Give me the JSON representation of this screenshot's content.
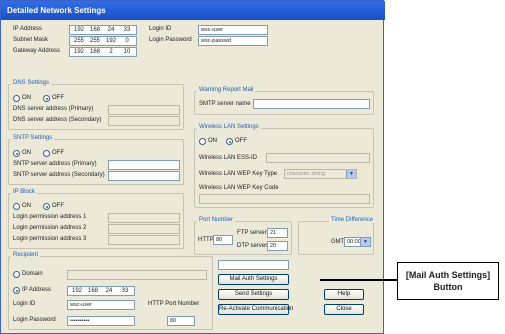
{
  "window": {
    "title": "Detailed Network Settings"
  },
  "network": {
    "ip_label": "IP Address",
    "ip": [
      "192",
      "168",
      "24",
      "33"
    ],
    "mask_label": "Subnet Mask",
    "mask": [
      "255",
      "255",
      "192",
      "0"
    ],
    "gateway_label": "Gateway Address",
    "gateway": [
      "192",
      "168",
      "2",
      "10"
    ],
    "login_id_label": "Login ID",
    "login_id": "wsc-user",
    "login_pw_label": "Login Password",
    "login_pw": "wsc-passwd"
  },
  "dns": {
    "title": "DNS Settings",
    "on": "ON",
    "off": "OFF",
    "primary_label": "DNS server address (Primary)",
    "secondary_label": "DNS server address (Secondary)"
  },
  "sntp": {
    "title": "SNTP Settings",
    "on": "ON",
    "off": "OFF",
    "primary_label": "SNTP server address (Primary)",
    "secondary_label": "SNTP server address (Secondary)"
  },
  "ipblock": {
    "title": "IP Block",
    "on": "ON",
    "off": "OFF",
    "addr1_label": "Login permission address 1",
    "addr2_label": "Login permission address 2",
    "addr3_label": "Login permission address 3"
  },
  "recipient": {
    "title": "Recipient",
    "domain_label": "Domain",
    "ip_label": "IP Address",
    "ip": [
      "192",
      "168",
      "24",
      "33"
    ],
    "login_id_label": "Login ID",
    "login_id": "wsc-user",
    "login_pw_label": "Login Password",
    "login_pw": "••••••••••",
    "http_port_label": "HTTP Port Number",
    "http_port": "80"
  },
  "warning": {
    "title": "Warning Report Mail",
    "smtp_label": "SMTP server name"
  },
  "wlan": {
    "title": "Wireless LAN Settings",
    "on": "ON",
    "off": "OFF",
    "essid_label": "Wireless LAN ESS-ID",
    "wep_type_label": "Wireless LAN WEP Key Type",
    "wep_type_value": "character string",
    "wep_code_label": "Wireless LAN WEP Key Code"
  },
  "port": {
    "title": "Port Number",
    "http_label": "HTTP",
    "http": "80",
    "ftp_label": "FTP server",
    "ftp": "21",
    "dtp_label": "DTP server",
    "dtp": "20"
  },
  "time": {
    "title": "Time Difference",
    "gmt_label": "GMT",
    "gmt": "00:00"
  },
  "buttons": {
    "mail_auth": "Mail Auth Settings",
    "send": "Send Settings",
    "help": "Help",
    "reactivate": "Re-Activate Communication",
    "close": "Close"
  },
  "callout": {
    "line1": "[Mail Auth Settings]",
    "line2": "Button"
  },
  "colors": {
    "titlebar": "#1a4fc4",
    "group_title": "#1f5fb5",
    "window_bg": "#ece9d8"
  }
}
